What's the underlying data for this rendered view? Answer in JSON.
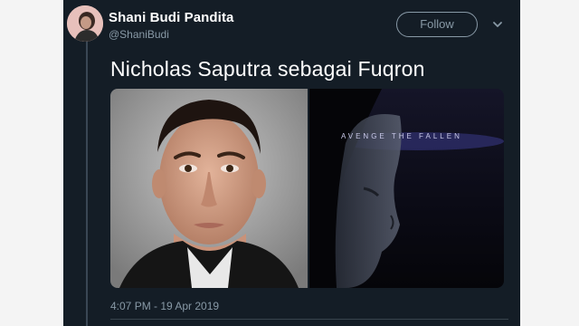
{
  "tweet": {
    "display_name": "Shani Budi Pandita",
    "handle": "@ShaniBudi",
    "follow_label": "Follow",
    "text": "Nicholas Saputra sebagai Fuqron",
    "timestamp": "4:07 PM - 19 Apr 2019",
    "poster_caption": "AVENGE THE FALLEN"
  },
  "icons": {
    "more": "chevron-down-icon",
    "avatar": "user-avatar"
  },
  "colors": {
    "background": "#141d26",
    "text_primary": "#ffffff",
    "text_secondary": "#8899a6",
    "poster_tint": "#2a2a66"
  }
}
